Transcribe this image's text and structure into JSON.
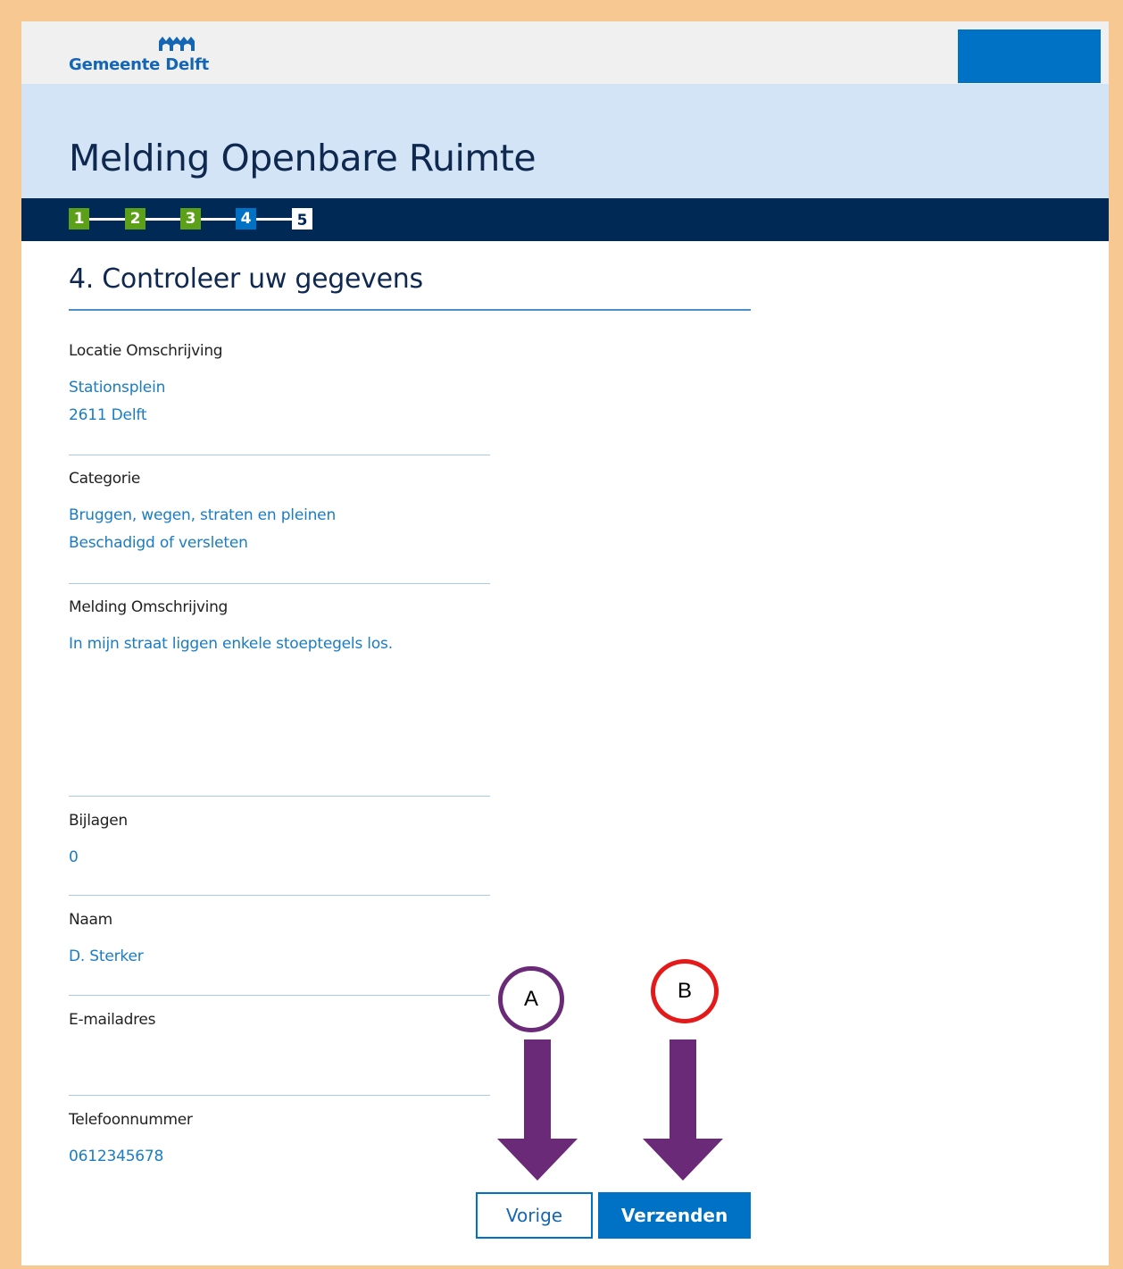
{
  "header": {
    "logo_text": "Gemeente Delft",
    "title": "Melding Openbare Ruimte"
  },
  "steps": [
    {
      "label": "1",
      "state": "done"
    },
    {
      "label": "2",
      "state": "done"
    },
    {
      "label": "3",
      "state": "done"
    },
    {
      "label": "4",
      "state": "active"
    },
    {
      "label": "5",
      "state": "todo"
    }
  ],
  "section": {
    "title": "4. Controleer uw gegevens"
  },
  "fields": {
    "location": {
      "label": "Locatie Omschrijving",
      "line1": "Stationsplein",
      "line2": "2611 Delft"
    },
    "category": {
      "label": "Categorie",
      "line1": "Bruggen, wegen, straten en pleinen",
      "line2": "Beschadigd of versleten"
    },
    "description": {
      "label": "Melding Omschrijving",
      "line1": "In mijn straat liggen enkele stoeptegels los."
    },
    "attachments": {
      "label": "Bijlagen",
      "value": "0"
    },
    "name": {
      "label": "Naam",
      "value": "D. Sterker"
    },
    "email": {
      "label": "E-mailadres",
      "value": ""
    },
    "phone": {
      "label": "Telefoonnummer",
      "value": "0612345678"
    }
  },
  "buttons": {
    "previous": "Vorige",
    "send": "Verzenden"
  },
  "annotations": {
    "marker_a": "A",
    "marker_b": "B"
  },
  "colors": {
    "brand_blue": "#0072c6",
    "dark_navy": "#002a55",
    "step_done": "#5ca019",
    "annotation_arrow": "#6a2a78",
    "marker_b_ring": "#e41919",
    "frame": "#f7c891"
  }
}
